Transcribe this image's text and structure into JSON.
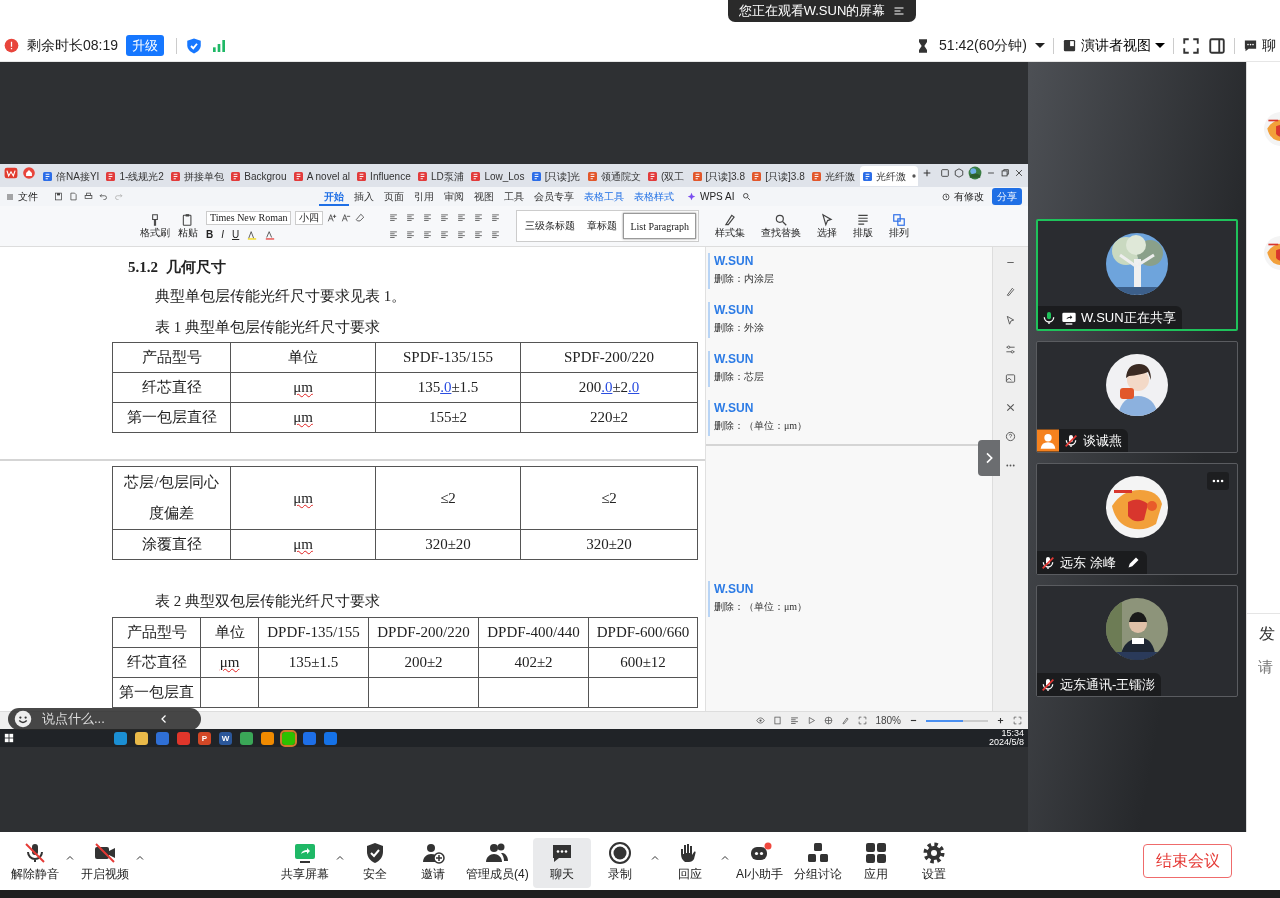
{
  "banner": {
    "text": "您正在观看W.SUN的屏幕"
  },
  "top_bar": {
    "remaining": "剩余时长08:19",
    "upgrade": "升级",
    "timer": "51:42(60分钟)",
    "view": "演讲者视图",
    "chat_tab": "聊"
  },
  "shared_screen": {
    "doc_tabs": [
      {
        "label": "倍NA接YI",
        "kind": "word",
        "selected": false
      },
      {
        "label": "1-线规光2",
        "kind": "pdf",
        "selected": false
      },
      {
        "label": "拼接单包",
        "kind": "pdf",
        "selected": false
      },
      {
        "label": "Backgrou",
        "kind": "pdf",
        "selected": false
      },
      {
        "label": "A novel al",
        "kind": "pdf",
        "selected": false
      },
      {
        "label": "Influence",
        "kind": "pdf",
        "selected": false
      },
      {
        "label": "LD泵浦",
        "kind": "pdf",
        "selected": false
      },
      {
        "label": "Low_Los",
        "kind": "pdf",
        "selected": false
      },
      {
        "label": "[只读]光",
        "kind": "word",
        "selected": false
      },
      {
        "label": "领通院文",
        "kind": "ppt",
        "selected": false
      },
      {
        "label": "(双工",
        "kind": "pdf",
        "selected": false
      },
      {
        "label": "[只读]3.8",
        "kind": "ppt",
        "selected": false
      },
      {
        "label": "[只读]3.8",
        "kind": "ppt",
        "selected": false
      },
      {
        "label": "光纤激",
        "kind": "ppt",
        "selected": false
      },
      {
        "label": "光纤激",
        "kind": "word",
        "selected": true
      }
    ],
    "menu": {
      "file": "文件",
      "tabs": [
        {
          "label": "开始",
          "selected": true,
          "contextual": false
        },
        {
          "label": "插入",
          "selected": false,
          "contextual": false
        },
        {
          "label": "页面",
          "selected": false,
          "contextual": false
        },
        {
          "label": "引用",
          "selected": false,
          "contextual": false
        },
        {
          "label": "审阅",
          "selected": false,
          "contextual": false
        },
        {
          "label": "视图",
          "selected": false,
          "contextual": false
        },
        {
          "label": "工具",
          "selected": false,
          "contextual": false
        },
        {
          "label": "会员专享",
          "selected": false,
          "contextual": false
        },
        {
          "label": "表格工具",
          "selected": false,
          "contextual": true
        },
        {
          "label": "表格样式",
          "selected": false,
          "contextual": true
        }
      ],
      "ai": "WPS AI",
      "modified": "有修改",
      "share": "分享"
    },
    "ribbon": {
      "format_painter": "格式刷",
      "paste": "粘贴",
      "font": "Times New Roman",
      "size": "小四",
      "format": [
        "B",
        "I",
        "U"
      ],
      "styles": [
        {
          "label": "三级条标题",
          "selected": false
        },
        {
          "label": "章标题",
          "selected": false
        },
        {
          "label": "List Paragraph",
          "selected": true
        }
      ],
      "commands": [
        "样式集",
        "查找替换",
        "选择",
        "排版",
        "排列"
      ]
    },
    "document": {
      "heading": "5.1.2  几何尺寸",
      "paragraph": "典型单包层传能光纤尺寸要求见表 1。",
      "table1": {
        "caption": "表 1  典型单包层传能光纤尺寸要求",
        "rows": [
          [
            "产品型号",
            "单位",
            "SPDF-135/155",
            "SPDF-200/220"
          ],
          [
            "纤芯直径",
            {
              "text": "μm",
              "misspelled": true
            },
            {
              "parts": [
                {
                  "text": "135",
                  "inserted": false
                },
                {
                  "text": ".0",
                  "inserted": true
                },
                {
                  "text": "±1.5",
                  "inserted": false
                }
              ]
            },
            {
              "parts": [
                {
                  "text": "200",
                  "inserted": false
                },
                {
                  "text": ".0",
                  "inserted": true
                },
                {
                  "text": "±2",
                  "inserted": false
                },
                {
                  "text": ".0",
                  "inserted": true
                }
              ]
            }
          ],
          [
            "第一包层直径",
            {
              "text": "μm",
              "misspelled": true
            },
            "155±2",
            "220±2"
          ]
        ],
        "continued_rows": [
          [
            "芯层/包层同心度偏差",
            {
              "text": "μm",
              "misspelled": true
            },
            "≤2",
            "≤2"
          ],
          [
            "涂覆直径",
            {
              "text": "μm",
              "misspelled": true
            },
            "320±20",
            "320±20"
          ]
        ]
      },
      "table2": {
        "caption": "表 2  典型双包层传能光纤尺寸要求",
        "rows": [
          [
            "产品型号",
            "单位",
            "DPDF-135/155",
            "DPDF-200/220",
            "DPDF-400/440",
            "DPDF-600/660"
          ],
          [
            "纤芯直径",
            {
              "text": "μm",
              "misspelled": true
            },
            "135±1.5",
            "200±2",
            "402±2",
            "600±12"
          ],
          [
            "第一包层直",
            "",
            "",
            "",
            "",
            ""
          ]
        ]
      }
    },
    "comments": [
      {
        "author": "W.SUN",
        "text": "删除：内涂层"
      },
      {
        "author": "W.SUN",
        "text": "删除：外涂"
      },
      {
        "author": "W.SUN",
        "text": "删除：芯层"
      },
      {
        "author": "W.SUN",
        "text": "删除：（单位：μm）"
      },
      {
        "author": "W.SUN",
        "text": "删除：（单位：μm）"
      }
    ],
    "status": {
      "zoom": "180%",
      "zoom_slider": {
        "level": 0.6
      }
    },
    "taskbar": {
      "apps": [
        {
          "color": "#1b8fd4",
          "selected": false
        },
        {
          "color": "#e9b949",
          "selected": false
        },
        {
          "color": "#2f6fd6",
          "selected": false
        },
        {
          "color": "#e0362b",
          "selected": false
        },
        {
          "color": "#d24726",
          "glyph": "P",
          "selected": false
        },
        {
          "color": "#2b579a",
          "glyph": "W",
          "selected": false
        },
        {
          "color": "#3aa757",
          "selected": false
        },
        {
          "color": "#f08a00",
          "selected": false
        },
        {
          "color": "#2dc100",
          "selected": true
        },
        {
          "color": "#1e6fe8",
          "selected": false
        },
        {
          "color": "#1572e8",
          "selected": false
        }
      ],
      "time": "15:34",
      "date": "2024/5/8"
    }
  },
  "danmaku_input": {
    "placeholder": "说点什么..."
  },
  "participants": [
    {
      "name": "W.SUN正在共享",
      "muted": false,
      "sharing": true,
      "active": true,
      "host_badge": false,
      "more_menu": false,
      "editing": false
    },
    {
      "name": "谈诚燕",
      "muted": true,
      "sharing": false,
      "active": false,
      "host_badge": true,
      "more_menu": false,
      "editing": false
    },
    {
      "name": "远东 涂峰",
      "muted": true,
      "sharing": false,
      "active": false,
      "host_badge": false,
      "more_menu": true,
      "editing": true
    },
    {
      "name": "远东通讯-王镭澎",
      "muted": true,
      "sharing": false,
      "active": false,
      "host_badge": false,
      "more_menu": false,
      "editing": false
    }
  ],
  "chat_panel": {
    "send_label": "发",
    "input_placeholder": "请"
  },
  "toolbar": [
    {
      "label": "解除静音",
      "kind": "mic",
      "off": true,
      "caret": true,
      "selected": false
    },
    {
      "label": "开启视频",
      "kind": "video",
      "off": true,
      "caret": true,
      "selected": false
    },
    {
      "label": "共享屏幕",
      "kind": "share",
      "off": false,
      "caret": true,
      "selected": false
    },
    {
      "label": "安全",
      "kind": "shield",
      "off": false,
      "caret": false,
      "selected": false
    },
    {
      "label": "邀请",
      "kind": "invite",
      "off": false,
      "caret": false,
      "selected": false
    },
    {
      "label": "管理成员(4)",
      "kind": "members",
      "off": false,
      "caret": false,
      "selected": false
    },
    {
      "label": "聊天",
      "kind": "chat",
      "off": false,
      "caret": false,
      "selected": true
    },
    {
      "label": "录制",
      "kind": "record",
      "off": false,
      "caret": true,
      "selected": false
    },
    {
      "label": "回应",
      "kind": "reaction",
      "off": false,
      "caret": true,
      "selected": false
    },
    {
      "label": "AI小助手",
      "kind": "ai",
      "off": false,
      "caret": false,
      "selected": false
    },
    {
      "label": "分组讨论",
      "kind": "breakout",
      "off": false,
      "caret": false,
      "selected": false
    },
    {
      "label": "应用",
      "kind": "apps",
      "off": false,
      "caret": false,
      "selected": false
    },
    {
      "label": "设置",
      "kind": "settings",
      "off": false,
      "caret": false,
      "selected": false
    }
  ],
  "end_button": "结束会议"
}
